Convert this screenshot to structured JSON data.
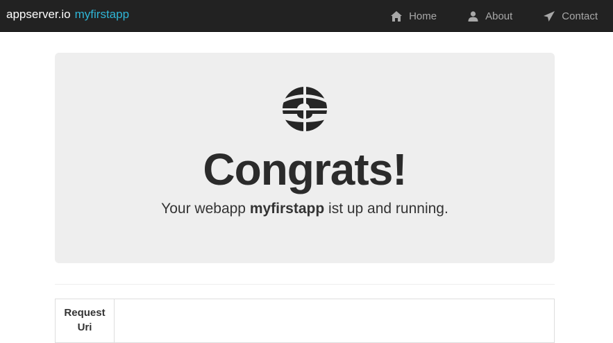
{
  "navbar": {
    "brand": "appserver.io",
    "app_name": "myfirstapp",
    "items": [
      {
        "label": "Home",
        "icon": "home-icon"
      },
      {
        "label": "About",
        "icon": "user-icon"
      },
      {
        "label": "Contact",
        "icon": "send-icon"
      }
    ]
  },
  "hero": {
    "logo_icon": "appserver-logo-icon",
    "title": "Congrats!",
    "lead_prefix": "Your webapp",
    "lead_app": "myfirstapp",
    "lead_suffix": "ist up and running."
  },
  "table": {
    "rows": [
      {
        "label_line1": "Request",
        "label_line2": "Uri",
        "value": ""
      }
    ]
  },
  "colors": {
    "navbar_bg": "#222222",
    "brand_accent": "#2fb5d6",
    "jumbotron_bg": "#eeeeee"
  }
}
